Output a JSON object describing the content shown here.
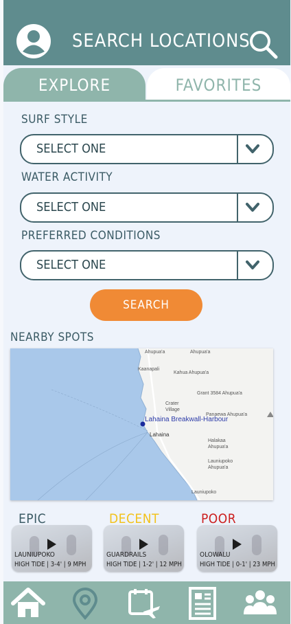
{
  "header": {
    "title": "SEARCH LOCATIONS",
    "avatar_icon": "user-avatar-icon",
    "search_icon": "search-icon"
  },
  "tabs": {
    "explore": "EXPLORE",
    "favorites": "FAVORITES",
    "active": "explore"
  },
  "form": {
    "surf_style": {
      "label": "SURF STYLE",
      "value": "SELECT ONE"
    },
    "water_activity": {
      "label": "WATER ACTIVITY",
      "value": "SELECT ONE"
    },
    "preferred_conditions": {
      "label": "PREFERRED CONDITIONS",
      "value": "SELECT ONE"
    },
    "search_button": "SEARCH"
  },
  "nearby": {
    "heading": "NEARBY SPOTS",
    "map": {
      "place_labels": [
        "Kaanapali",
        "Kahua Ahupua'a",
        "Ahupua'a",
        "Crater Village",
        "Grant 3584 Ahupua'a",
        "Panaewa Ahupua'a",
        "Lahaina",
        "Halakaa Ahupua'a",
        "Launiupoko Ahupua'a",
        "Launiupoko",
        "Ahupua'a"
      ],
      "marker_label": "Lahaina Breakwall-Harbour"
    }
  },
  "ratings": [
    {
      "label": "EPIC",
      "color": "#3a5a64",
      "spot": "LAUNIUPOKO",
      "info": "HIGH TIDE | 3-4' | 9 MPH"
    },
    {
      "label": "DECENT",
      "color": "#f2c21c",
      "spot": "GUARDRAILS",
      "info": "HIGH TIDE | 1-2' | 12 MPH"
    },
    {
      "label": "POOR",
      "color": "#cc1f1f",
      "spot": "OLOWALU",
      "info": "HIGH TIDE | 0-1' | 23 MPH"
    }
  ],
  "bottom_nav": [
    "home-icon",
    "location-pin-icon",
    "travel-calendar-icon",
    "news-icon",
    "community-icon"
  ],
  "colors": {
    "header": "#5f8c8e",
    "tab_active": "#8fb5ab",
    "accent": "#f08a35",
    "background": "#eef3fb"
  }
}
